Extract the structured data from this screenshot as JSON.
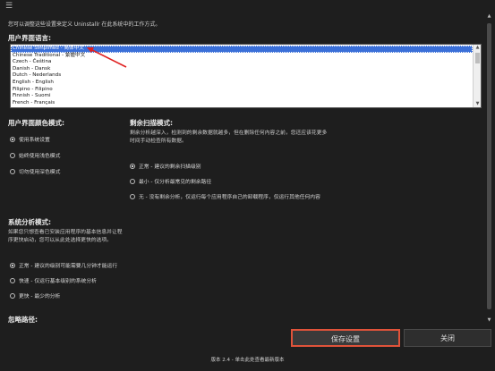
{
  "intro": "您可以调整这些设置来定义 Uninstallr 在此系统中的工作方式。",
  "language": {
    "title": "用户界面语言:",
    "items": [
      "Chinese Simplified - 简体中文",
      "Chinese Traditional - 繁體中文",
      "Czech - Čeština",
      "Danish - Dansk",
      "Dutch - Nederlands",
      "English - English",
      "Filipino - Filipino",
      "Finnish - Suomi",
      "French - Français"
    ],
    "selected_index": 0
  },
  "color_mode": {
    "title": "用户界面颜色模式:",
    "options": [
      "使用系统设置",
      "始终使用浅色模式",
      "切勿使用深色模式"
    ],
    "selected_index": 0
  },
  "leftover_scan": {
    "title": "剩余扫描模式:",
    "description_1": "剩余分析越深入，检测到的剩余数据就越多，但在删除任何内容之前，您还应该花更多",
    "description_2": "时间手动检查所有数据。",
    "options": [
      "正常 - 建议的剩余扫描级别",
      "最小 - 仅分析最常见的剩余路径",
      "无 - 没有剩余分析，仅运行每个应用程序自己的卸载程序，仅运行其他任何内容"
    ],
    "selected_index": 0
  },
  "system_analysis": {
    "title": "系统分析模式:",
    "description_1": "如果您只想查看已安装应用程序的基本信息并让程",
    "description_2": "序更快启动，您可以从此处选择更快的选项。",
    "options": [
      "正常 - 建议的级别可能需要几分钟才能运行",
      "快速 - 仅运行基本级别的系统分析",
      "更快 - 最少的分析"
    ],
    "selected_index": 0
  },
  "ignore_paths": {
    "title": "忽略路径:"
  },
  "buttons": {
    "save": "保存设置",
    "close": "关闭"
  },
  "footer": {
    "version": "版本 2.4 - 单击此处查看最新版本"
  },
  "colors": {
    "accent": "#3a6fd8",
    "highlight": "#e0533a",
    "annotation": "#e02020"
  }
}
